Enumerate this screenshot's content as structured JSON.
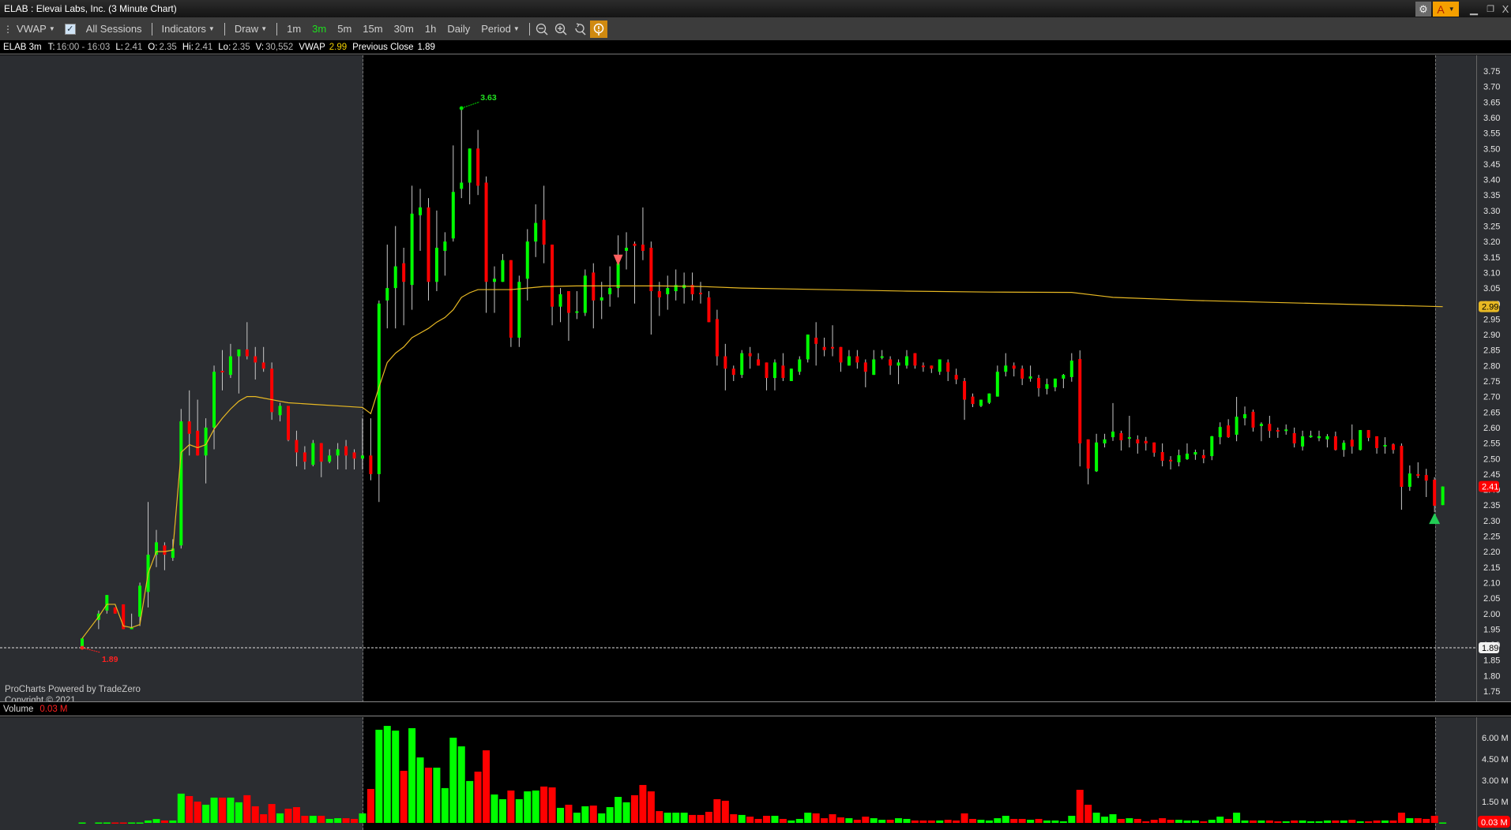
{
  "window": {
    "title": "ELAB : Elevai Labs, Inc. (3 Minute Chart)",
    "account_button": "A",
    "close_glyph": "X"
  },
  "toolbar": {
    "study": "VWAP",
    "all_sessions": "All Sessions",
    "indicators": "Indicators",
    "draw": "Draw",
    "timeframes": [
      "1m",
      "3m",
      "5m",
      "15m",
      "30m",
      "1h",
      "Daily"
    ],
    "active_timeframe": "3m",
    "period": "Period"
  },
  "info": {
    "symbol": "ELAB 3m",
    "t_label": "T:",
    "t_value": "16:00 - 16:03",
    "l_label": "L:",
    "l_value": "2.41",
    "o_label": "O:",
    "o_value": "2.35",
    "hi_label": "Hi:",
    "hi_value": "2.41",
    "lo_label": "Lo:",
    "lo_value": "2.35",
    "v_label": "V:",
    "v_value": "30,552",
    "vwap_label": "VWAP",
    "vwap_value": "2.99",
    "prev_close_label": "Previous Close",
    "prev_close_value": "1.89"
  },
  "branding": {
    "line1": "ProCharts Powered by TradeZero",
    "line2": "Copyright © 2021"
  },
  "volume_pane": {
    "label": "Volume",
    "current": "0.03 M"
  },
  "chart_data": {
    "type": "candlestick",
    "symbol": "ELAB",
    "interval": "3m",
    "price_range": [
      1.75,
      3.75
    ],
    "price_ticks": [
      "3.75",
      "3.70",
      "3.65",
      "3.60",
      "3.55",
      "3.50",
      "3.45",
      "3.40",
      "3.35",
      "3.30",
      "3.25",
      "3.20",
      "3.15",
      "3.10",
      "3.05",
      "3.00",
      "2.95",
      "2.90",
      "2.85",
      "2.80",
      "2.75",
      "2.70",
      "2.65",
      "2.60",
      "2.55",
      "2.50",
      "2.45",
      "2.40",
      "2.35",
      "2.30",
      "2.25",
      "2.20",
      "2.15",
      "2.10",
      "2.05",
      "2.00",
      "1.95",
      "1.90",
      "1.85",
      "1.80",
      "1.75"
    ],
    "volume_ticks": [
      {
        "label": "6.00 M",
        "value": 6.0
      },
      {
        "label": "4.50 M",
        "value": 4.5
      },
      {
        "label": "3.00 M",
        "value": 3.0
      },
      {
        "label": "1.50 M",
        "value": 1.5
      }
    ],
    "volume_unit": "M",
    "colors": {
      "up": "#00ff00",
      "down": "#ff0000",
      "wick": "#c8c8c8",
      "vwap": "#e8b923"
    },
    "session_boundaries": {
      "premarket_end_slot": 34,
      "afterhours_start_slot": 164.1
    },
    "candles_columns": [
      "open",
      "high",
      "low",
      "close",
      "volume"
    ],
    "candles": [
      [
        1.89,
        1.92,
        1.89,
        1.92,
        0.03
      ],
      null,
      [
        1.98,
        2.01,
        1.95,
        2.0,
        0.03
      ],
      [
        2.01,
        2.06,
        2.0,
        2.06,
        0.03
      ],
      [
        2.02,
        2.02,
        2.0,
        2.0,
        0.03
      ],
      [
        2.03,
        2.03,
        1.95,
        1.95,
        0.03
      ],
      [
        1.95,
        2.0,
        1.95,
        1.955,
        0.03
      ],
      [
        1.99,
        2.1,
        1.96,
        2.09,
        0.03
      ],
      [
        2.07,
        2.36,
        2.02,
        2.19,
        0.17
      ],
      [
        2.19,
        2.27,
        2.15,
        2.23,
        0.27
      ],
      [
        2.22,
        2.23,
        2.14,
        2.19,
        0.17
      ],
      [
        2.18,
        2.24,
        2.17,
        2.21,
        0.17
      ],
      [
        2.22,
        2.66,
        2.21,
        2.62,
        2.06
      ],
      [
        2.62,
        2.72,
        2.51,
        2.58,
        1.89
      ],
      [
        2.59,
        2.69,
        2.51,
        2.51,
        1.5
      ],
      [
        2.51,
        2.63,
        2.42,
        2.6,
        1.28
      ],
      [
        2.6,
        2.8,
        2.53,
        2.78,
        1.78
      ],
      [
        2.783,
        2.85,
        2.72,
        2.779,
        1.78
      ],
      [
        2.77,
        2.87,
        2.76,
        2.83,
        1.78
      ],
      [
        2.83,
        2.85,
        2.71,
        2.852,
        1.45
      ],
      [
        2.852,
        2.94,
        2.82,
        2.83,
        1.95
      ],
      [
        2.83,
        2.86,
        2.755,
        2.81,
        1.17
      ],
      [
        2.81,
        2.86,
        2.78,
        2.79,
        0.61
      ],
      [
        2.79,
        2.81,
        2.625,
        2.65,
        1.33
      ],
      [
        2.64,
        2.68,
        2.62,
        2.67,
        0.67
      ],
      [
        2.67,
        2.67,
        2.556,
        2.56,
        1.0
      ],
      [
        2.56,
        2.59,
        2.475,
        2.52,
        1.11
      ],
      [
        2.52,
        2.54,
        2.465,
        2.49,
        0.5
      ],
      [
        2.48,
        2.56,
        2.475,
        2.55,
        0.5
      ],
      [
        2.55,
        2.55,
        2.44,
        2.49,
        0.5
      ],
      [
        2.49,
        2.53,
        2.485,
        2.51,
        0.28
      ],
      [
        2.51,
        2.55,
        2.465,
        2.53,
        0.33
      ],
      [
        2.54,
        2.56,
        2.465,
        2.51,
        0.33
      ],
      [
        2.52,
        2.53,
        2.465,
        2.5,
        0.28
      ],
      [
        2.5,
        2.63,
        2.465,
        2.51,
        0.67
      ],
      [
        2.51,
        2.63,
        2.43,
        2.45,
        2.39
      ],
      [
        2.45,
        3.01,
        2.36,
        3.0,
        6.56
      ],
      [
        3.01,
        3.19,
        2.92,
        3.05,
        6.83
      ],
      [
        3.05,
        3.25,
        2.92,
        3.12,
        6.5
      ],
      [
        3.13,
        3.18,
        2.93,
        3.07,
        3.67
      ],
      [
        3.06,
        3.38,
        2.98,
        3.29,
        6.67
      ],
      [
        3.285,
        3.37,
        3.17,
        3.31,
        4.61
      ],
      [
        3.31,
        3.34,
        3.01,
        3.07,
        3.89
      ],
      [
        3.07,
        3.3,
        3.04,
        3.18,
        3.89
      ],
      [
        3.17,
        3.23,
        3.09,
        3.2,
        2.45
      ],
      [
        3.21,
        3.51,
        3.2,
        3.36,
        6.0
      ],
      [
        3.37,
        3.63,
        3.34,
        3.39,
        5.39
      ],
      [
        3.39,
        3.5,
        3.32,
        3.5,
        2.95
      ],
      [
        3.5,
        3.56,
        3.35,
        3.38,
        3.61
      ],
      [
        3.39,
        3.41,
        2.97,
        3.07,
        5.11
      ],
      [
        3.07,
        3.12,
        2.97,
        3.08,
        2.0
      ],
      [
        3.07,
        3.16,
        3.07,
        3.14,
        1.67
      ],
      [
        3.14,
        3.14,
        2.86,
        2.89,
        2.28
      ],
      [
        2.89,
        3.09,
        2.86,
        3.07,
        1.67
      ],
      [
        3.08,
        3.24,
        3.01,
        3.2,
        2.22
      ],
      [
        3.2,
        3.32,
        3.15,
        3.26,
        2.28
      ],
      [
        3.27,
        3.38,
        3.13,
        3.19,
        2.56
      ],
      [
        3.19,
        3.19,
        2.93,
        2.99,
        2.5
      ],
      [
        2.99,
        3.05,
        2.94,
        3.03,
        1.06
      ],
      [
        3.04,
        3.04,
        2.88,
        2.97,
        1.28
      ],
      [
        2.97,
        3.04,
        2.95,
        2.975,
        0.72
      ],
      [
        2.97,
        3.11,
        2.96,
        3.09,
        1.17
      ],
      [
        3.1,
        3.13,
        2.92,
        3.01,
        1.22
      ],
      [
        3.01,
        3.07,
        2.95,
        3.02,
        0.67
      ],
      [
        3.03,
        3.12,
        2.99,
        3.05,
        1.11
      ],
      [
        3.05,
        3.22,
        3.02,
        3.13,
        1.83
      ],
      [
        3.17,
        3.23,
        3.11,
        3.18,
        1.45
      ],
      [
        3.193,
        3.2,
        3.0,
        3.186,
        1.95
      ],
      [
        3.19,
        3.31,
        3.14,
        3.17,
        2.67
      ],
      [
        3.18,
        3.2,
        2.9,
        3.04,
        2.22
      ],
      [
        3.04,
        3.07,
        2.96,
        3.02,
        0.83
      ],
      [
        3.03,
        3.09,
        2.98,
        3.05,
        0.72
      ],
      [
        3.04,
        3.11,
        3.01,
        3.06,
        0.72
      ],
      [
        3.05,
        3.1,
        3.0,
        3.06,
        0.72
      ],
      [
        3.06,
        3.1,
        3.01,
        3.03,
        0.56
      ],
      [
        3.035,
        3.07,
        3.0,
        3.03,
        0.56
      ],
      [
        3.02,
        3.04,
        2.94,
        2.94,
        0.78
      ],
      [
        2.95,
        2.98,
        2.8,
        2.83,
        1.67
      ],
      [
        2.83,
        2.87,
        2.72,
        2.79,
        1.56
      ],
      [
        2.79,
        2.8,
        2.75,
        2.77,
        0.61
      ],
      [
        2.77,
        2.85,
        2.76,
        2.84,
        0.56
      ],
      [
        2.84,
        2.86,
        2.79,
        2.83,
        0.44
      ],
      [
        2.82,
        2.84,
        2.8,
        2.8,
        0.28
      ],
      [
        2.81,
        2.81,
        2.72,
        2.76,
        0.5
      ],
      [
        2.76,
        2.82,
        2.72,
        2.81,
        0.5
      ],
      [
        2.8,
        2.84,
        2.75,
        2.76,
        0.28
      ],
      [
        2.75,
        2.79,
        2.75,
        2.79,
        0.17
      ],
      [
        2.78,
        2.83,
        2.77,
        2.82,
        0.28
      ],
      [
        2.82,
        2.9,
        2.81,
        2.9,
        0.72
      ],
      [
        2.89,
        2.94,
        2.8,
        2.87,
        0.67
      ],
      [
        2.86,
        2.89,
        2.83,
        2.85,
        0.33
      ],
      [
        2.86,
        2.93,
        2.83,
        2.855,
        0.61
      ],
      [
        2.86,
        2.86,
        2.78,
        2.81,
        0.39
      ],
      [
        2.8,
        2.85,
        2.8,
        2.83,
        0.33
      ],
      [
        2.83,
        2.85,
        2.79,
        2.81,
        0.22
      ],
      [
        2.81,
        2.82,
        2.73,
        2.78,
        0.44
      ],
      [
        2.77,
        2.85,
        2.77,
        2.82,
        0.33
      ],
      [
        2.825,
        2.85,
        2.82,
        2.83,
        0.22
      ],
      [
        2.82,
        2.83,
        2.77,
        2.8,
        0.22
      ],
      [
        2.8,
        2.82,
        2.74,
        2.81,
        0.33
      ],
      [
        2.8,
        2.85,
        2.79,
        2.83,
        0.28
      ],
      [
        2.84,
        2.84,
        2.79,
        2.8,
        0.17
      ],
      [
        2.8,
        2.81,
        2.78,
        2.795,
        0.17
      ],
      [
        2.8,
        2.8,
        2.776,
        2.79,
        0.17
      ],
      [
        2.78,
        2.82,
        2.77,
        2.82,
        0.17
      ],
      [
        2.81,
        2.82,
        2.75,
        2.78,
        0.22
      ],
      [
        2.77,
        2.79,
        2.74,
        2.755,
        0.17
      ],
      [
        2.75,
        2.76,
        2.625,
        2.69,
        0.67
      ],
      [
        2.7,
        2.71,
        2.666,
        2.676,
        0.28
      ],
      [
        2.67,
        2.69,
        2.666,
        2.69,
        0.22
      ],
      [
        2.68,
        2.71,
        2.676,
        2.71,
        0.17
      ],
      [
        2.7,
        2.8,
        2.7,
        2.78,
        0.33
      ],
      [
        2.78,
        2.84,
        2.765,
        2.8,
        0.5
      ],
      [
        2.8,
        2.81,
        2.765,
        2.79,
        0.28
      ],
      [
        2.79,
        2.8,
        2.737,
        2.758,
        0.28
      ],
      [
        2.758,
        2.8,
        2.748,
        2.765,
        0.22
      ],
      [
        2.76,
        2.77,
        2.7,
        2.727,
        0.28
      ],
      [
        2.725,
        2.758,
        2.707,
        2.74,
        0.17
      ],
      [
        2.73,
        2.758,
        2.717,
        2.758,
        0.17
      ],
      [
        2.758,
        2.773,
        2.727,
        2.77,
        0.11
      ],
      [
        2.763,
        2.84,
        2.748,
        2.816,
        0.5
      ],
      [
        2.821,
        2.849,
        2.475,
        2.549,
        2.33
      ],
      [
        2.562,
        2.562,
        2.417,
        2.468,
        1.28
      ],
      [
        2.459,
        2.58,
        2.457,
        2.552,
        0.72
      ],
      [
        2.549,
        2.58,
        2.536,
        2.562,
        0.44
      ],
      [
        2.569,
        2.679,
        2.557,
        2.587,
        0.61
      ],
      [
        2.582,
        2.59,
        2.526,
        2.559,
        0.28
      ],
      [
        2.564,
        2.638,
        2.536,
        2.569,
        0.33
      ],
      [
        2.562,
        2.575,
        2.516,
        2.549,
        0.28
      ],
      [
        2.557,
        2.57,
        2.526,
        2.549,
        0.11
      ],
      [
        2.552,
        2.552,
        2.506,
        2.519,
        0.22
      ],
      [
        2.521,
        2.549,
        2.475,
        2.493,
        0.33
      ],
      [
        2.496,
        2.508,
        2.465,
        2.491,
        0.22
      ],
      [
        2.488,
        2.529,
        2.475,
        2.511,
        0.22
      ],
      [
        2.498,
        2.549,
        2.496,
        2.516,
        0.17
      ],
      [
        2.513,
        2.529,
        2.496,
        2.521,
        0.17
      ],
      [
        2.511,
        2.529,
        2.485,
        2.501,
        0.11
      ],
      [
        2.508,
        2.573,
        2.495,
        2.572,
        0.22
      ],
      [
        2.569,
        2.617,
        2.546,
        2.602,
        0.44
      ],
      [
        2.607,
        2.627,
        2.567,
        2.569,
        0.28
      ],
      [
        2.577,
        2.699,
        2.556,
        2.635,
        0.72
      ],
      [
        2.63,
        2.668,
        2.607,
        2.643,
        0.17
      ],
      [
        2.651,
        2.658,
        2.587,
        2.6,
        0.17
      ],
      [
        2.605,
        2.617,
        2.556,
        2.612,
        0.17
      ],
      [
        2.612,
        2.638,
        2.567,
        2.589,
        0.17
      ],
      [
        2.592,
        2.6,
        2.567,
        2.587,
        0.11
      ],
      [
        2.589,
        2.61,
        2.577,
        2.594,
        0.11
      ],
      [
        2.582,
        2.6,
        2.536,
        2.549,
        0.17
      ],
      [
        2.539,
        2.59,
        2.526,
        2.572,
        0.17
      ],
      [
        2.569,
        2.59,
        2.567,
        2.574,
        0.11
      ],
      [
        2.566,
        2.59,
        2.556,
        2.572,
        0.11
      ],
      [
        2.562,
        2.579,
        2.536,
        2.572,
        0.17
      ],
      [
        2.572,
        2.587,
        2.526,
        2.528,
        0.17
      ],
      [
        2.528,
        2.559,
        2.506,
        2.551,
        0.17
      ],
      [
        2.561,
        2.61,
        2.516,
        2.539,
        0.22
      ],
      [
        2.528,
        2.592,
        2.526,
        2.592,
        0.11
      ],
      [
        2.592,
        2.592,
        2.556,
        2.567,
        0.11
      ],
      [
        2.572,
        2.572,
        2.516,
        2.534,
        0.17
      ],
      [
        2.539,
        2.569,
        2.516,
        2.544,
        0.17
      ],
      [
        2.546,
        2.549,
        2.516,
        2.528,
        0.17
      ],
      [
        2.541,
        2.549,
        2.335,
        2.409,
        0.72
      ],
      [
        2.409,
        2.478,
        2.396,
        2.452,
        0.33
      ],
      [
        2.45,
        2.488,
        2.437,
        2.444,
        0.33
      ],
      [
        2.447,
        2.467,
        2.376,
        2.429,
        0.28
      ],
      [
        2.432,
        2.44,
        2.327,
        2.348,
        0.5
      ],
      [
        2.35,
        2.41,
        2.35,
        2.41,
        0.03
      ]
    ],
    "vwap": [
      [
        0,
        1.92
      ],
      [
        2,
        1.99
      ],
      [
        3,
        2.03
      ],
      [
        4,
        2.03
      ],
      [
        5,
        1.96
      ],
      [
        6,
        1.955
      ],
      [
        7,
        1.965
      ],
      [
        8,
        2.13
      ],
      [
        9,
        2.2
      ],
      [
        10,
        2.2
      ],
      [
        11,
        2.205
      ],
      [
        12,
        2.52
      ],
      [
        13,
        2.545
      ],
      [
        14,
        2.535
      ],
      [
        15,
        2.545
      ],
      [
        16,
        2.595
      ],
      [
        17,
        2.63
      ],
      [
        18,
        2.66
      ],
      [
        19,
        2.685
      ],
      [
        20,
        2.7
      ],
      [
        21,
        2.7
      ],
      [
        22,
        2.695
      ],
      [
        23,
        2.69
      ],
      [
        25,
        2.68
      ],
      [
        28,
        2.675
      ],
      [
        31,
        2.67
      ],
      [
        34,
        2.665
      ],
      [
        35,
        2.645
      ],
      [
        36,
        2.73
      ],
      [
        37,
        2.81
      ],
      [
        38,
        2.84
      ],
      [
        39,
        2.86
      ],
      [
        40,
        2.89
      ],
      [
        41,
        2.905
      ],
      [
        42,
        2.92
      ],
      [
        43,
        2.94
      ],
      [
        44,
        2.955
      ],
      [
        45,
        2.98
      ],
      [
        46,
        3.02
      ],
      [
        47,
        3.035
      ],
      [
        48,
        3.045
      ],
      [
        52,
        3.045
      ],
      [
        54,
        3.05
      ],
      [
        56,
        3.055
      ],
      [
        60,
        3.057
      ],
      [
        70,
        3.057
      ],
      [
        75,
        3.055
      ],
      [
        80,
        3.05
      ],
      [
        90,
        3.045
      ],
      [
        100,
        3.04
      ],
      [
        110,
        3.037
      ],
      [
        120,
        3.036
      ],
      [
        125,
        3.02
      ],
      [
        135,
        3.01
      ],
      [
        150,
        3.0
      ],
      [
        165,
        2.99
      ]
    ],
    "annotations": {
      "high": {
        "slot": 46,
        "price": 3.63,
        "label": "3.63"
      },
      "low": {
        "slot": 0,
        "price": 1.89,
        "label": "1.89"
      },
      "sell_marker": {
        "slot": 65,
        "price": 3.14
      },
      "buy_marker": {
        "slot": 164,
        "price": 2.307
      }
    },
    "price_tags": {
      "vwap": {
        "value": 2.99,
        "label": "2.99"
      },
      "last": {
        "value": 2.41,
        "label": "2.41"
      },
      "prev_close": {
        "value": 1.89,
        "label": "1.89"
      }
    },
    "volume_tag": {
      "value": 0.03,
      "label": "0.03 M"
    }
  }
}
